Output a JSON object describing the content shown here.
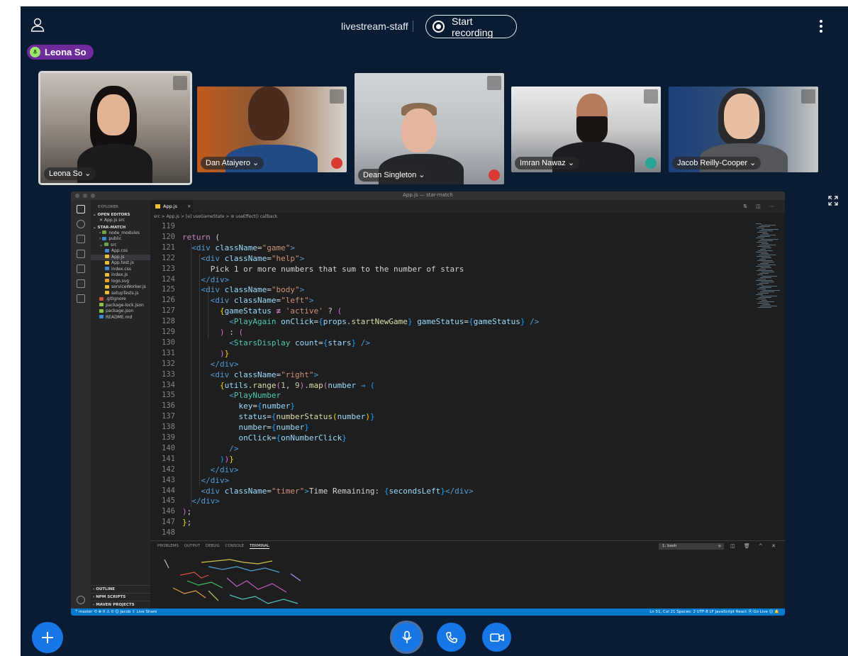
{
  "topbar": {
    "room_name": "livestream-staff",
    "record_label": "Start recording"
  },
  "active_speaker": {
    "name": "Leona So"
  },
  "participants": [
    {
      "name": "Leona So ⌄",
      "status": "speaking"
    },
    {
      "name": "Dan Ataiyero ⌄",
      "status": "muted"
    },
    {
      "name": "Dean Singleton ⌄",
      "status": "muted"
    },
    {
      "name": "Imran Nawaz ⌄",
      "status": "headphones"
    },
    {
      "name": "Jacob Reilly-Cooper ⌄",
      "status": "unmuted"
    }
  ],
  "editor": {
    "window_title": "App.js — star-match",
    "tab_label": "App.js",
    "breadcrumb": "src > App.js > [e] useGameState > ⊚ useEffect() callback",
    "explorer": {
      "header": "EXPLORER",
      "open_editors_label": "OPEN EDITORS",
      "open_file": "✕ App.js  src",
      "project_label": "STAR-MATCH",
      "tree": [
        "node_modules",
        "public",
        "src",
        "App.css",
        "App.js",
        "App.test.js",
        "index.css",
        "index.js",
        "logo.svg",
        "serviceWorker.js",
        "setupTests.js",
        ".gitignore",
        "package-lock.json",
        "package.json",
        "README.md"
      ],
      "bottom_sections": [
        "OUTLINE",
        "NPM SCRIPTS",
        "MAVEN PROJECTS"
      ]
    },
    "code_lines": [
      {
        "n": "119",
        "html": ""
      },
      {
        "n": "120",
        "html": "<span class='k'>return</span> ("
      },
      {
        "n": "121",
        "html": "  <span class='t'>&lt;div</span> <span class='a'>className</span>=<span class='s'>\"game\"</span><span class='t'>&gt;</span>"
      },
      {
        "n": "122",
        "html": "    <span class='t'>&lt;div</span> <span class='a'>className</span>=<span class='s'>\"help\"</span><span class='t'>&gt;</span>"
      },
      {
        "n": "123",
        "html": "      Pick 1 or more numbers that sum to the number of stars"
      },
      {
        "n": "124",
        "html": "    <span class='t'>&lt;/div&gt;</span>"
      },
      {
        "n": "125",
        "html": "    <span class='t'>&lt;div</span> <span class='a'>className</span>=<span class='s'>\"body\"</span><span class='t'>&gt;</span>"
      },
      {
        "n": "126",
        "html": "      <span class='t'>&lt;div</span> <span class='a'>className</span>=<span class='s'>\"left\"</span><span class='t'>&gt;</span>"
      },
      {
        "n": "127",
        "html": "        <span class='b'>{</span><span class='a'>gameStatus</span> <span class='k'>≢</span> <span class='s'>'active'</span> ? <span class='p'>(</span>"
      },
      {
        "n": "128",
        "html": "          <span class='t'>&lt;</span><span class='g'>PlayAgain</span> <span class='a'>onClick</span>=<span class='br'>{</span><span class='a'>props</span>.<span class='f'>startNewGame</span><span class='br'>}</span> <span class='a'>gameStatus</span>=<span class='br'>{</span><span class='a'>gameStatus</span><span class='br'>}</span> <span class='t'>/&gt;</span>"
      },
      {
        "n": "129",
        "html": "        <span class='p'>)</span> : <span class='p'>(</span>"
      },
      {
        "n": "130",
        "html": "          <span class='t'>&lt;</span><span class='g'>StarsDisplay</span> <span class='a'>count</span>=<span class='br'>{</span><span class='a'>stars</span><span class='br'>}</span> <span class='t'>/&gt;</span>"
      },
      {
        "n": "131",
        "html": "        <span class='p'>)</span><span class='b'>}</span>"
      },
      {
        "n": "132",
        "html": "      <span class='t'>&lt;/div&gt;</span>"
      },
      {
        "n": "133",
        "html": "      <span class='t'>&lt;div</span> <span class='a'>className</span>=<span class='s'>\"right\"</span><span class='t'>&gt;</span>"
      },
      {
        "n": "134",
        "html": "        <span class='b'>{</span><span class='a'>utils</span>.<span class='f'>range</span><span class='p'>(</span><span class='n'>1</span>, <span class='n'>9</span><span class='p'>)</span>.<span class='f'>map</span><span class='p'>(</span><span class='a'>number</span> <span class='t'>⇒</span> <span class='br'>(</span>"
      },
      {
        "n": "135",
        "html": "          <span class='t'>&lt;</span><span class='g'>PlayNumber</span>"
      },
      {
        "n": "136",
        "html": "            <span class='a'>key</span>=<span class='br'>{</span><span class='a'>number</span><span class='br'>}</span>"
      },
      {
        "n": "137",
        "html": "            <span class='a'>status</span>=<span class='br'>{</span><span class='f'>numberStatus</span><span class='b'>(</span><span class='a'>number</span><span class='b'>)</span><span class='br'>}</span>"
      },
      {
        "n": "138",
        "html": "            <span class='a'>number</span>=<span class='br'>{</span><span class='a'>number</span><span class='br'>}</span>"
      },
      {
        "n": "139",
        "html": "            <span class='a'>onClick</span>=<span class='br'>{</span><span class='a'>onNumberClick</span><span class='br'>}</span>"
      },
      {
        "n": "140",
        "html": "          <span class='t'>/&gt;</span>"
      },
      {
        "n": "141",
        "html": "        <span class='br'>)</span><span class='p'>)</span><span class='b'>}</span>"
      },
      {
        "n": "142",
        "html": "      <span class='t'>&lt;/div&gt;</span>"
      },
      {
        "n": "143",
        "html": "    <span class='t'>&lt;/div&gt;</span>"
      },
      {
        "n": "144",
        "html": "    <span class='t'>&lt;div</span> <span class='a'>className</span>=<span class='s'>\"timer\"</span><span class='t'>&gt;</span>Time Remaining: <span class='br'>{</span><span class='a'>secondsLeft</span><span class='br'>}</span><span class='t'>&lt;/div&gt;</span>"
      },
      {
        "n": "145",
        "html": "  <span class='t'>&lt;/div&gt;</span>"
      },
      {
        "n": "146",
        "html": "<span class='p'>)</span>;"
      },
      {
        "n": "147",
        "html": "<span class='b'>}</span>;"
      },
      {
        "n": "148",
        "html": ""
      }
    ],
    "panel_tabs": [
      "PROBLEMS",
      "OUTPUT",
      "DEBUG CONSOLE",
      "TERMINAL"
    ],
    "active_panel_tab": "TERMINAL",
    "terminal_select": "1: bash",
    "statusbar_left": "ᛘ master   ⟲   ⊗ 0 ⚠ 0   ☺ Jacob   ⇪ Live Share",
    "statusbar_right": "Ln 51, Col 21   Spaces: 2   UTF-8   LF   JavaScript React   ⦿ Go Live   ☺   🔔"
  },
  "colors": {
    "background": "#0a1c33",
    "accent": "#1877e6",
    "speaker_badge": "#6f2a9b",
    "muted": "#d93a31",
    "headphones": "#27a599",
    "statusbar": "#007acc"
  }
}
